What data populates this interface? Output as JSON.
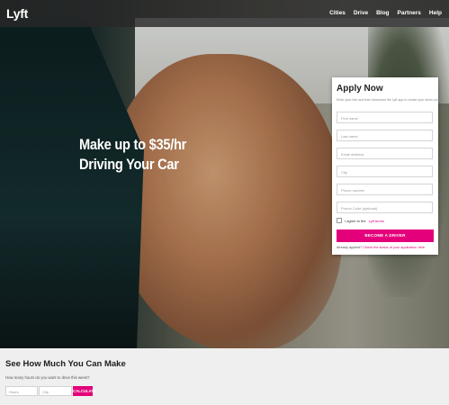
{
  "brand": {
    "logo": "Lyft",
    "accent": "#e4007a"
  },
  "nav": {
    "items": [
      "Cities",
      "Drive",
      "Blog",
      "Partners",
      "Help"
    ]
  },
  "hero": {
    "headline_line1": "Make up to $35/hr",
    "headline_line2": "Driving Your Car"
  },
  "apply": {
    "title": "Apply Now",
    "subtitle": "Enter your info and then download the Lyft app to create your driver profile.",
    "fields": [
      "First name",
      "Last name",
      "Email address",
      "City",
      "Phone number",
      "Promo Code (optional)"
    ],
    "agree_prefix": "I agree to the",
    "agree_link": "Lyft terms",
    "button": "BECOME A DRIVER",
    "already_prefix": "Already applied?",
    "already_link": "Check the status of your application here"
  },
  "calculator": {
    "title": "See How Much You Can Make",
    "question": "How many hours do you want to drive this week?",
    "hours_placeholder": "Hours",
    "city_placeholder": "City",
    "button": "CALCULATE"
  }
}
